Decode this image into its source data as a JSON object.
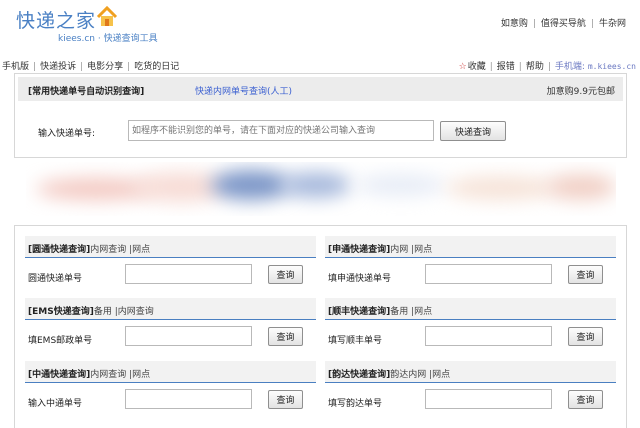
{
  "header": {
    "logo_text": "快递之家",
    "logo_sub": "kiees.cn · 快递查询工具",
    "top_links": [
      "如意购",
      "值得买导航",
      "牛杂网"
    ]
  },
  "nav": {
    "left": [
      "手机版",
      "快递投诉",
      "电影分享",
      "吃货的日记"
    ],
    "favorite": "收藏",
    "report": "报错",
    "help": "帮助",
    "mobile_label": "手机端:",
    "mobile_url": "m.kiees.cn"
  },
  "auto_search": {
    "title": "[常用快递单号自动识别查询]",
    "manual_link": "快递内网单号查询(人工)",
    "promo": "加意购9.9元包邮",
    "label": "输入快递单号:",
    "placeholder": "如程序不能识别您的单号，请在下面对应的快递公司输入查询",
    "button": "快递查询"
  },
  "couriers": [
    {
      "title": "[圆通快递查询]",
      "links": "内网查询 |网点",
      "label": "圆通快递单号",
      "button": "查询"
    },
    {
      "title": "[申通快递查询]",
      "links": "内网 |网点",
      "label": "填申通快递单号",
      "button": "查询"
    },
    {
      "title": "[EMS快递查询]",
      "links": "备用 |内网查询",
      "label": "填EMS邮政单号",
      "button": "查询"
    },
    {
      "title": "[顺丰快递查询]",
      "links": "备用 |网点",
      "label": "填写顺丰单号",
      "button": "查询"
    },
    {
      "title": "[中通快递查询]",
      "links": "内网查询 |网点",
      "label": "输入中通单号",
      "button": "查询"
    },
    {
      "title": "[韵达快递查询]",
      "links": "韵达内网 |网点",
      "label": "填写韵达单号",
      "button": "查询"
    }
  ],
  "colors": {
    "brand_blue": "#4a80c4",
    "link_blue": "#3a5fd1",
    "header_underline": "#4a7fc1"
  }
}
